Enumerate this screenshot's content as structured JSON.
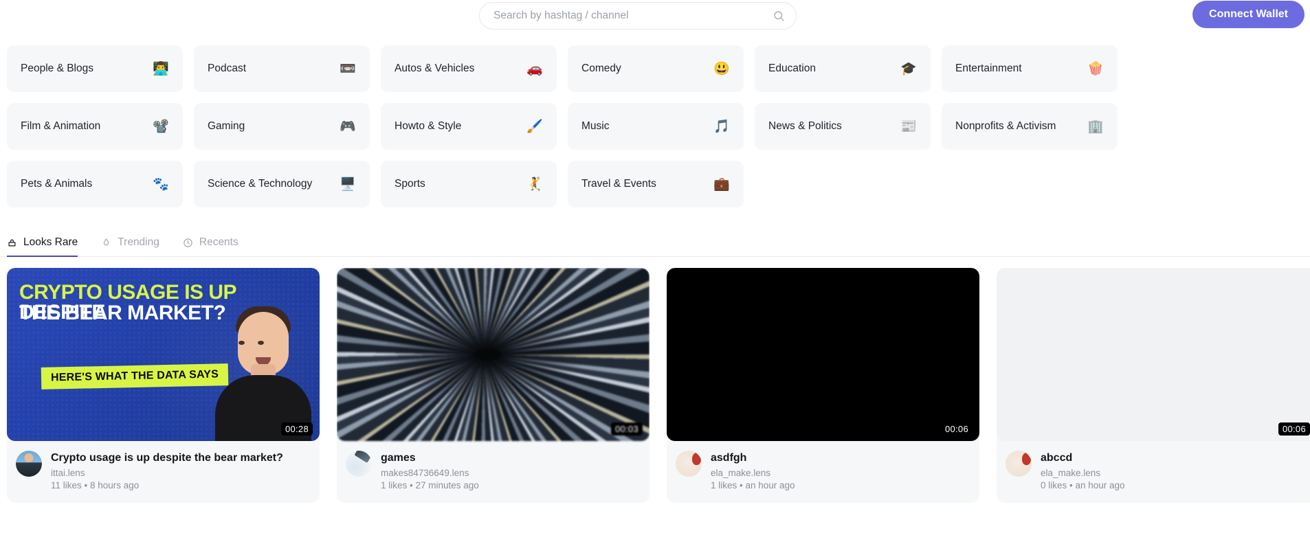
{
  "header": {
    "search": {
      "placeholder": "Search by hashtag / channel",
      "value": "",
      "icon": "search-icon"
    },
    "connect_wallet_label": "Connect Wallet",
    "accent_color": "#6c6ce0"
  },
  "categories": [
    {
      "label": "People & Blogs",
      "emoji": "👨‍💻",
      "icon": "person-at-computer-icon"
    },
    {
      "label": "Podcast",
      "emoji": "📼",
      "icon": "podcast-icon"
    },
    {
      "label": "Autos & Vehicles",
      "emoji": "🚗",
      "icon": "car-icon"
    },
    {
      "label": "Comedy",
      "emoji": "😃",
      "icon": "smile-icon"
    },
    {
      "label": "Education",
      "emoji": "🎓",
      "icon": "graduation-cap-icon"
    },
    {
      "label": "Entertainment",
      "emoji": "🍿",
      "icon": "popcorn-icon"
    },
    {
      "label": "Film & Animation",
      "emoji": "📽️",
      "icon": "projector-icon"
    },
    {
      "label": "Gaming",
      "emoji": "🎮",
      "icon": "gamepad-icon"
    },
    {
      "label": "Howto & Style",
      "emoji": "🖌️",
      "icon": "paintbrush-icon"
    },
    {
      "label": "Music",
      "emoji": "🎵",
      "icon": "music-note-icon"
    },
    {
      "label": "News & Politics",
      "emoji": "📰",
      "icon": "newspaper-icon"
    },
    {
      "label": "Nonprofits & Activism",
      "emoji": "🏢",
      "icon": "office-building-icon"
    },
    {
      "label": "Pets & Animals",
      "emoji": "🐾",
      "icon": "paw-print-icon"
    },
    {
      "label": "Science & Technology",
      "emoji": "🖥️",
      "icon": "chip-icon"
    },
    {
      "label": "Sports",
      "emoji": "🤾",
      "icon": "handball-player-icon"
    },
    {
      "label": "Travel & Events",
      "emoji": "💼",
      "icon": "briefcase-icon"
    }
  ],
  "tabs": [
    {
      "label": "Looks Rare",
      "icon": "gem-icon",
      "active": true
    },
    {
      "label": "Trending",
      "icon": "flame-icon",
      "active": false
    },
    {
      "label": "Recents",
      "icon": "clock-icon",
      "active": false
    }
  ],
  "videos": [
    {
      "title": "Crypto usage is up despite the bear market?",
      "handle": "ittai.lens",
      "stats": "11 likes • 8 hours ago",
      "likes": "11 likes",
      "time": "8 hours ago",
      "duration": "00:28",
      "thumb_kind": "crypto-graphic",
      "thumb_text": {
        "line1_highlight": "CRYPTO USAGE IS UP",
        "line1_rest": "DESPITE",
        "line2": "THE BEAR MARKET?",
        "badge": "HERE'S WHAT THE DATA SAYS"
      }
    },
    {
      "title": "games",
      "handle": "makes84736649.lens",
      "stats": "1 likes • 27 minutes ago",
      "likes": "1 likes",
      "time": "27 minutes ago",
      "duration": "00:03",
      "thumb_kind": "tunnel-motion-blur",
      "thumb_text": null
    },
    {
      "title": "asdfgh",
      "handle": "ela_make.lens",
      "stats": "1 likes • an hour ago",
      "likes": "1 likes",
      "time": "an hour ago",
      "duration": "00:06",
      "thumb_kind": "black",
      "thumb_text": null
    },
    {
      "title": "abccd",
      "handle": "ela_make.lens",
      "stats": "0 likes • an hour ago",
      "likes": "0 likes",
      "time": "an hour ago",
      "duration": "00:06",
      "thumb_kind": "light-gray",
      "thumb_text": null
    }
  ]
}
